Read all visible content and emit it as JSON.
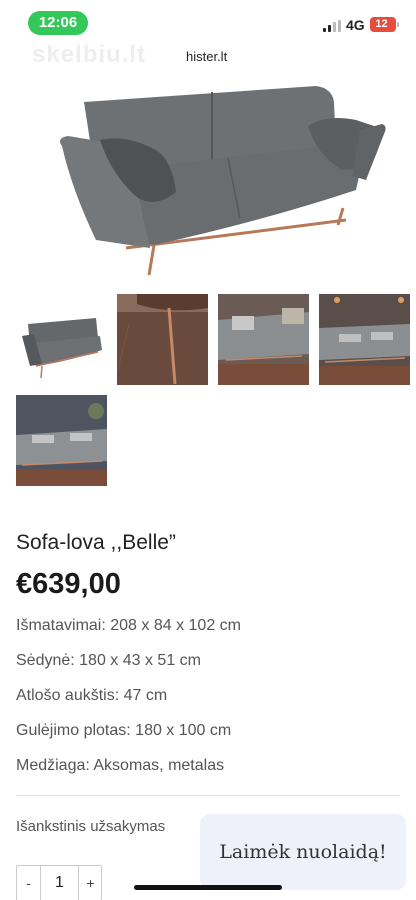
{
  "status_bar": {
    "time": "12:06",
    "network": "4G",
    "battery": "12",
    "colors": {
      "time_pill": "#34c759",
      "battery": "#e74c3c"
    }
  },
  "browser": {
    "watermark": "skelbiu.lt",
    "url": "hister.lt"
  },
  "gallery": {
    "main_image": "grey-velvet-sofa-bed-with-copper-legs",
    "thumbnails": [
      {
        "name": "sofa-front"
      },
      {
        "name": "copper-leg-closeup"
      },
      {
        "name": "sofa-in-room-with-pillows"
      },
      {
        "name": "sofa-room-side"
      },
      {
        "name": "sofa-room-wide"
      }
    ]
  },
  "product": {
    "title": "Sofa-lova ,,Belle”",
    "price": "€639,00",
    "specs": [
      "Išmatavimai: 208 x 84 x 102 cm",
      "Sėdynė: 180 x 43 x 51 cm",
      "Atlošo aukštis: 47 cm",
      "Gulėjimo plotas: 180 x 100 cm",
      "Medžiaga: Aksomas, metalas"
    ],
    "availability": "Išankstinis užsakymas"
  },
  "quantity": {
    "minus": "-",
    "value": "1",
    "plus": "+"
  },
  "promo": {
    "label": "Laimėk nuolaidą!"
  }
}
